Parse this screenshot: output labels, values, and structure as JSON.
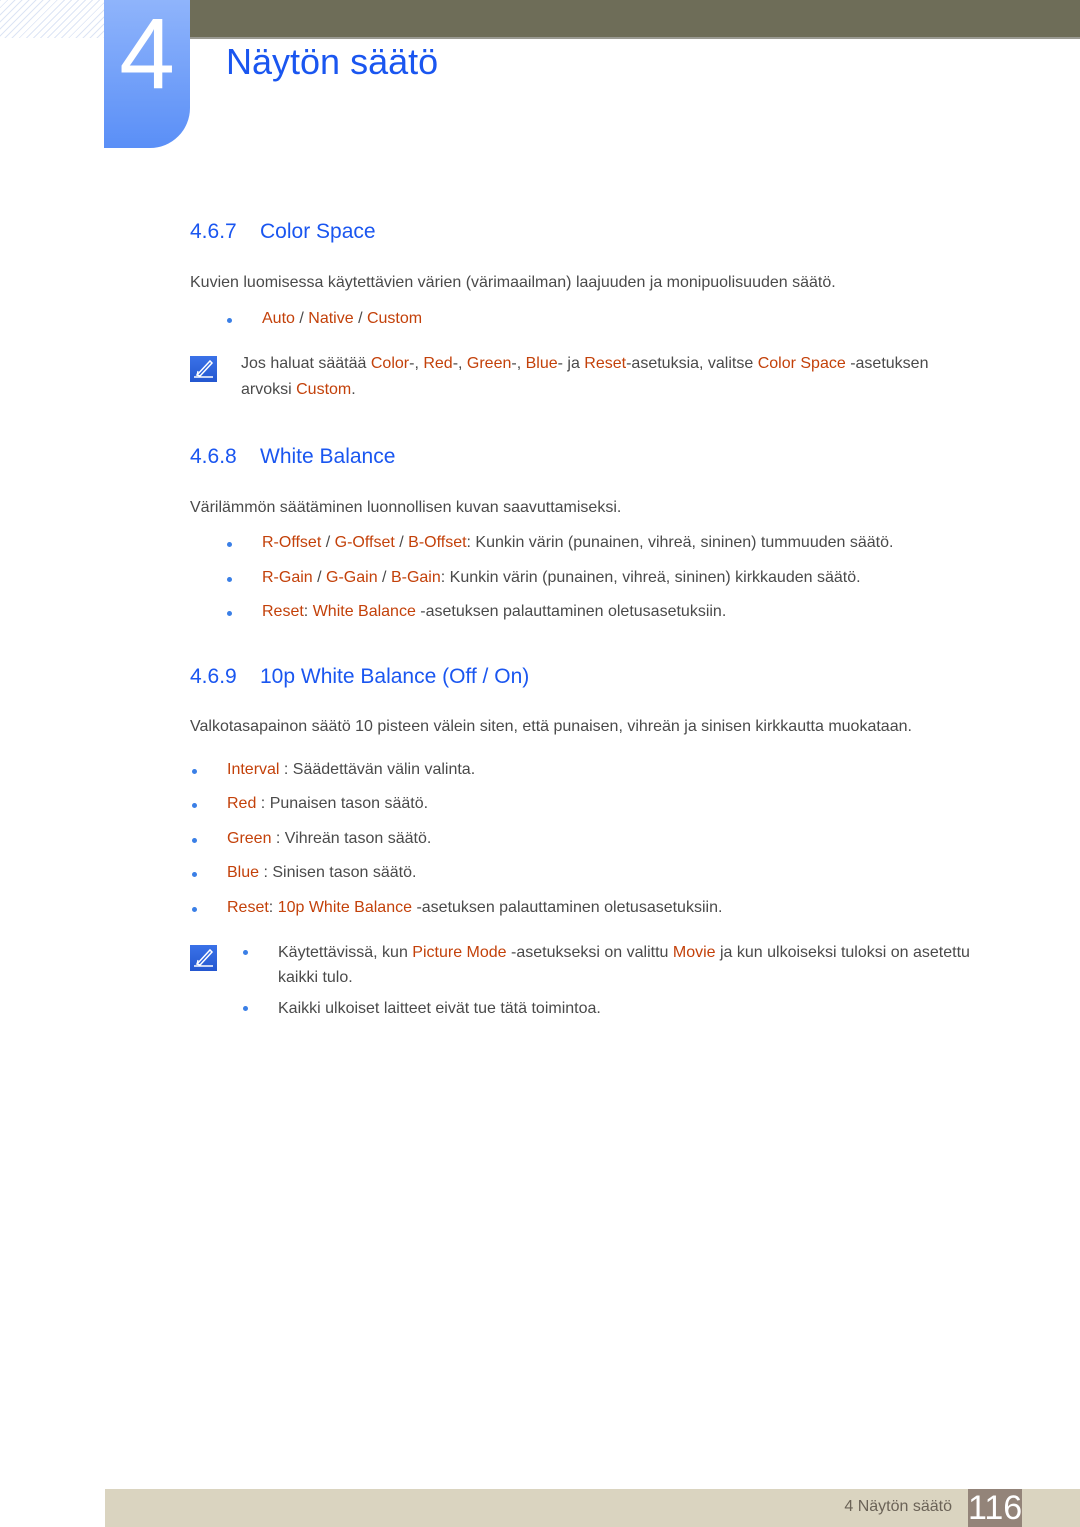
{
  "chapter": {
    "number": "4",
    "title": "Näytön säätö"
  },
  "sections": [
    {
      "number": "4.6.7",
      "title": "Color Space",
      "intro": "Kuvien luomisessa käytettävien värien (värimaailman) laajuuden ja monipuolisuuden säätö.",
      "options": {
        "a": "Auto",
        "sep1": " / ",
        "b": "Native",
        "sep2": " / ",
        "c": "Custom"
      },
      "note": {
        "t1": "Jos haluat säätää ",
        "h1": "Color",
        "t2": "-, ",
        "h2": "Red",
        "t3": "-, ",
        "h3": "Green",
        "t4": "-, ",
        "h4": "Blue",
        "t5": "- ja ",
        "h5": "Reset",
        "t6": "-asetuksia, valitse ",
        "h6": "Color Space",
        "t7": " -asetuksen arvoksi ",
        "h7": "Custom",
        "t8": "."
      }
    },
    {
      "number": "4.6.8",
      "title": "White Balance",
      "intro": "Värilämmön säätäminen luonnollisen kuvan saavuttamiseksi.",
      "bullets": [
        {
          "h1": "R-Offset",
          "s1": " / ",
          "h2": "G-Offset",
          "s2": " / ",
          "h3": "B-Offset",
          "text": ": Kunkin värin (punainen, vihreä, sininen) tummuuden säätö."
        },
        {
          "h1": "R-Gain",
          "s1": " / ",
          "h2": "G-Gain",
          "s2": " / ",
          "h3": "B-Gain",
          "text": ": Kunkin värin (punainen, vihreä, sininen) kirkkauden säätö."
        },
        {
          "h1": "Reset",
          "s1": ": ",
          "h2": "White Balance",
          "text": " -asetuksen palauttaminen oletusasetuksiin."
        }
      ]
    },
    {
      "number": "4.6.9",
      "title": "10p White Balance (Off / On)",
      "intro": "Valkotasapainon säätö 10 pisteen välein siten, että punaisen, vihreän ja sinisen kirkkautta muokataan.",
      "bullets": [
        {
          "h1": "Interval",
          "text": " : Säädettävän välin valinta."
        },
        {
          "h1": "Red",
          "text": " : Punaisen tason säätö."
        },
        {
          "h1": "Green",
          "text": " : Vihreän tason säätö."
        },
        {
          "h1": "Blue",
          "text": " : Sinisen tason säätö."
        },
        {
          "h1": "Reset",
          "s1": ": ",
          "h2": "10p White Balance",
          "text": " -asetuksen palauttaminen oletusasetuksiin."
        }
      ],
      "notes": [
        {
          "t1": "Käytettävissä, kun ",
          "h1": "Picture Mode",
          "t2": " -asetukseksi on valittu ",
          "h2": "Movie",
          "t3": " ja kun ulkoiseksi tuloksi on asetettu kaikki tulo."
        },
        {
          "t1": "Kaikki ulkoiset laitteet eivät tue tätä toimintoa."
        }
      ]
    }
  ],
  "footer": {
    "label": "4 Näytön säätö",
    "page": "116"
  },
  "icons": {
    "note": "note-pencil-icon",
    "bullet": "bullet-dot-icon"
  },
  "colors": {
    "heading": "#1a56f0",
    "highlight": "#c3410a",
    "bullet": "#3a7fe6",
    "topbar": "#6e6d58",
    "footer": "#dad4c0",
    "page_box": "#938479"
  }
}
